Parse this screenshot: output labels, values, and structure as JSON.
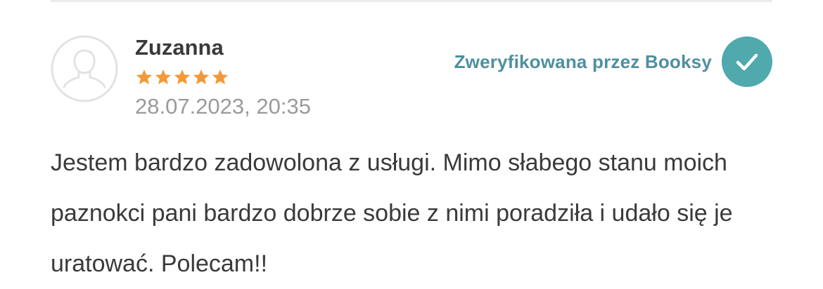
{
  "review": {
    "author": "Zuzanna",
    "rating": 5,
    "rating_max": 5,
    "date": "28.07.2023, 20:35",
    "verified_label": "Zweryfikowana przez Booksy",
    "text": "Jestem bardzo zadowolona z usługi. Mimo słabego stanu moich paznokci pani bardzo dobrze sobie z nimi poradziła i udało się je uratować. Polecam!!"
  },
  "icons": {
    "avatar": "user-placeholder-icon",
    "star": "star-icon",
    "verified": "check-circle-icon"
  },
  "colors": {
    "star": "#f29a3a",
    "verified_text": "#4e8fa0",
    "verified_badge": "#4fa9ad",
    "body_text": "#3a3a3a",
    "date_text": "#9a9a9a"
  }
}
